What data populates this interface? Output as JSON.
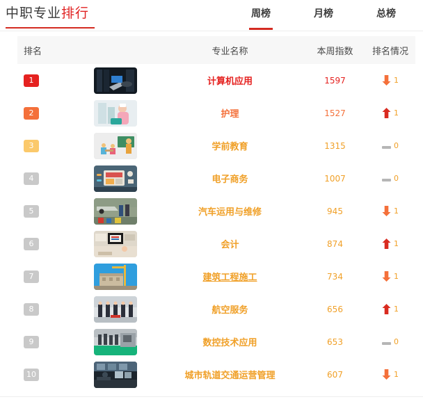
{
  "header": {
    "brand_main": "中职专业",
    "brand_accent": "排行",
    "tabs": [
      {
        "label": "周榜",
        "active": true
      },
      {
        "label": "月榜",
        "active": false
      },
      {
        "label": "总榜",
        "active": false
      }
    ]
  },
  "table": {
    "columns": {
      "rank": "排名",
      "thumb": "",
      "name": "专业名称",
      "index": "本周指数",
      "change": "排名情况"
    },
    "rows": [
      {
        "rank": "1",
        "name": "计算机应用",
        "index": "1597",
        "change": "1",
        "direction": "down",
        "thumb": "computer-lab-photo"
      },
      {
        "rank": "2",
        "name": "护理",
        "index": "1527",
        "change": "1",
        "direction": "up",
        "thumb": "nurse-photo"
      },
      {
        "rank": "3",
        "name": "学前教育",
        "index": "1315",
        "change": "0",
        "direction": "flat",
        "thumb": "preschool-illustration"
      },
      {
        "rank": "4",
        "name": "电子商务",
        "index": "1007",
        "change": "0",
        "direction": "flat",
        "thumb": "ecommerce-illustration"
      },
      {
        "rank": "5",
        "name": "汽车运用与维修",
        "index": "945",
        "change": "1",
        "direction": "down",
        "thumb": "auto-repair-photo"
      },
      {
        "rank": "6",
        "name": "会计",
        "index": "874",
        "change": "1",
        "direction": "up",
        "thumb": "accounting-photo"
      },
      {
        "rank": "7",
        "name": "建筑工程施工",
        "index": "734",
        "change": "1",
        "direction": "down",
        "thumb": "construction-photo"
      },
      {
        "rank": "8",
        "name": "航空服务",
        "index": "656",
        "change": "1",
        "direction": "up",
        "thumb": "flight-crew-photo"
      },
      {
        "rank": "9",
        "name": "数控技术应用",
        "index": "653",
        "change": "0",
        "direction": "flat",
        "thumb": "cnc-workshop-photo"
      },
      {
        "rank": "10",
        "name": "城市轨道交通运营管理",
        "index": "607",
        "change": "1",
        "direction": "down",
        "thumb": "rail-control-room-photo"
      }
    ]
  },
  "colors": {
    "rank1": "#e52220",
    "rank2": "#f4703a",
    "rank3": "#fbc96b",
    "rank_other": "#c9c9c9",
    "accent_red": "#d42b21",
    "name_rest": "#f0a028",
    "arrow_up": "#d92b20",
    "arrow_down": "#f4703a",
    "dash": "#b6b6b6"
  }
}
